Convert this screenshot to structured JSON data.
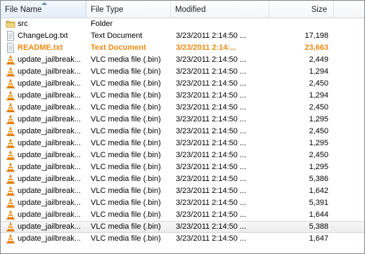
{
  "columns": {
    "name": "File Name",
    "type": "File Type",
    "modified": "Modified",
    "size": "Size"
  },
  "files": [
    {
      "name": "src",
      "type": "Folder",
      "modified": "",
      "size": "",
      "icon": "folder-icon"
    },
    {
      "name": "ChangeLog.txt",
      "type": "Text Document",
      "modified": "3/23/2011 2:14:50 ...",
      "size": "17,198",
      "icon": "text-file-icon"
    },
    {
      "name": "README.txt",
      "type": "Text Document",
      "modified": "3/23/2011 2:14:...",
      "size": "23,663",
      "icon": "text-file-icon",
      "highlight": true
    },
    {
      "name": "update_jailbreak...",
      "type": "VLC media file (.bin)",
      "modified": "3/23/2011 2:14:50 ...",
      "size": "2,449",
      "icon": "vlc-cone-icon"
    },
    {
      "name": "update_jailbreak...",
      "type": "VLC media file (.bin)",
      "modified": "3/23/2011 2:14:50 ...",
      "size": "1,294",
      "icon": "vlc-cone-icon"
    },
    {
      "name": "update_jailbreak...",
      "type": "VLC media file (.bin)",
      "modified": "3/23/2011 2:14:50 ...",
      "size": "2,450",
      "icon": "vlc-cone-icon"
    },
    {
      "name": "update_jailbreak...",
      "type": "VLC media file (.bin)",
      "modified": "3/23/2011 2:14:50 ...",
      "size": "1,294",
      "icon": "vlc-cone-icon"
    },
    {
      "name": "update_jailbreak...",
      "type": "VLC media file (.bin)",
      "modified": "3/23/2011 2:14:50 ...",
      "size": "2,450",
      "icon": "vlc-cone-icon"
    },
    {
      "name": "update_jailbreak...",
      "type": "VLC media file (.bin)",
      "modified": "3/23/2011 2:14:50 ...",
      "size": "1,295",
      "icon": "vlc-cone-icon"
    },
    {
      "name": "update_jailbreak...",
      "type": "VLC media file (.bin)",
      "modified": "3/23/2011 2:14:50 ...",
      "size": "2,450",
      "icon": "vlc-cone-icon"
    },
    {
      "name": "update_jailbreak...",
      "type": "VLC media file (.bin)",
      "modified": "3/23/2011 2:14:50 ...",
      "size": "1,295",
      "icon": "vlc-cone-icon"
    },
    {
      "name": "update_jailbreak...",
      "type": "VLC media file (.bin)",
      "modified": "3/23/2011 2:14:50 ...",
      "size": "2,450",
      "icon": "vlc-cone-icon"
    },
    {
      "name": "update_jailbreak...",
      "type": "VLC media file (.bin)",
      "modified": "3/23/2011 2:14:50 ...",
      "size": "1,295",
      "icon": "vlc-cone-icon"
    },
    {
      "name": "update_jailbreak...",
      "type": "VLC media file (.bin)",
      "modified": "3/23/2011 2:14:50 ...",
      "size": "5,386",
      "icon": "vlc-cone-icon"
    },
    {
      "name": "update_jailbreak...",
      "type": "VLC media file (.bin)",
      "modified": "3/23/2011 2:14:50 ...",
      "size": "1,642",
      "icon": "vlc-cone-icon"
    },
    {
      "name": "update_jailbreak...",
      "type": "VLC media file (.bin)",
      "modified": "3/23/2011 2:14:50 ...",
      "size": "5,391",
      "icon": "vlc-cone-icon"
    },
    {
      "name": "update_jailbreak...",
      "type": "VLC media file (.bin)",
      "modified": "3/23/2011 2:14:50 ...",
      "size": "1,644",
      "icon": "vlc-cone-icon"
    },
    {
      "name": "update_jailbreak...",
      "type": "VLC media file (.bin)",
      "modified": "3/23/2011 2:14:50 ...",
      "size": "5,388",
      "icon": "vlc-cone-icon",
      "selected": true
    },
    {
      "name": "update_jailbreak...",
      "type": "VLC media file (.bin)",
      "modified": "3/23/2011 2:14:50 ...",
      "size": "1,647",
      "icon": "vlc-cone-icon"
    }
  ],
  "colors": {
    "highlight_text": "#ee8a10",
    "vlc_orange": "#f28c00",
    "folder_yellow": "#e8c25a"
  }
}
